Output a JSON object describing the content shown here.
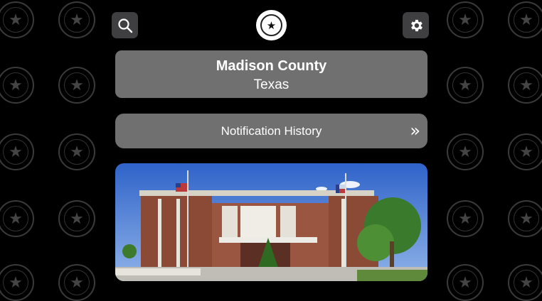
{
  "header": {
    "search_icon": "search-icon",
    "settings_icon": "gear-icon",
    "logo_icon": "county-seal-logo"
  },
  "county": {
    "name": "Madison County",
    "state": "Texas"
  },
  "notifications": {
    "label": "Notification History",
    "chevron": "»"
  },
  "photo": {
    "subject": "courthouse-image"
  },
  "colors": {
    "background": "#000000",
    "card": "#707070",
    "icon_button": "#3f3f41",
    "text": "#ffffff"
  }
}
